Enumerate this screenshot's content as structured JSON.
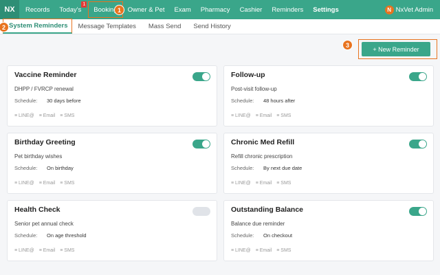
{
  "nav": {
    "logo": "NX",
    "items": [
      {
        "label": "Records"
      },
      {
        "label": "Today's",
        "badge": "1"
      },
      {
        "label": "Booking"
      },
      {
        "label": "Owner & Pet"
      },
      {
        "label": "Exam"
      },
      {
        "label": "Pharmacy"
      },
      {
        "label": "Cashier"
      },
      {
        "label": "Reminders"
      },
      {
        "label": "Settings"
      }
    ],
    "user": {
      "initial": "N",
      "name": "NxVet Admin"
    }
  },
  "steps": [
    "1",
    "2",
    "3"
  ],
  "subtabs": [
    "System Reminders",
    "Message Templates",
    "Mass Send",
    "Send History"
  ],
  "new_button": "+ New Reminder",
  "schedule_label": "Schedule:",
  "channels": [
    "≡ LINE@",
    "≡ Email",
    "≡ SMS"
  ],
  "cards": [
    {
      "title": "Vaccine Reminder",
      "description": "DHPP / FVRCP renewal",
      "schedule": "30 days before",
      "enabled": true
    },
    {
      "title": "Follow-up",
      "description": "Post-visit follow-up",
      "schedule": "48 hours after",
      "enabled": true
    },
    {
      "title": "Birthday Greeting",
      "description": "Pet birthday wishes",
      "schedule": "On birthday",
      "enabled": true
    },
    {
      "title": "Chronic Med Refill",
      "description": "Refill chronic prescription",
      "schedule": "By next due date",
      "enabled": true
    },
    {
      "title": "Health Check",
      "description": "Senior pet annual check",
      "schedule": "On age threshold",
      "enabled": false
    },
    {
      "title": "Outstanding Balance",
      "description": "Balance due reminder",
      "schedule": "On checkout",
      "enabled": true
    }
  ],
  "colors": {
    "brand": "#3aa68a",
    "highlight": "#e8731f",
    "badge": "#e53935"
  }
}
